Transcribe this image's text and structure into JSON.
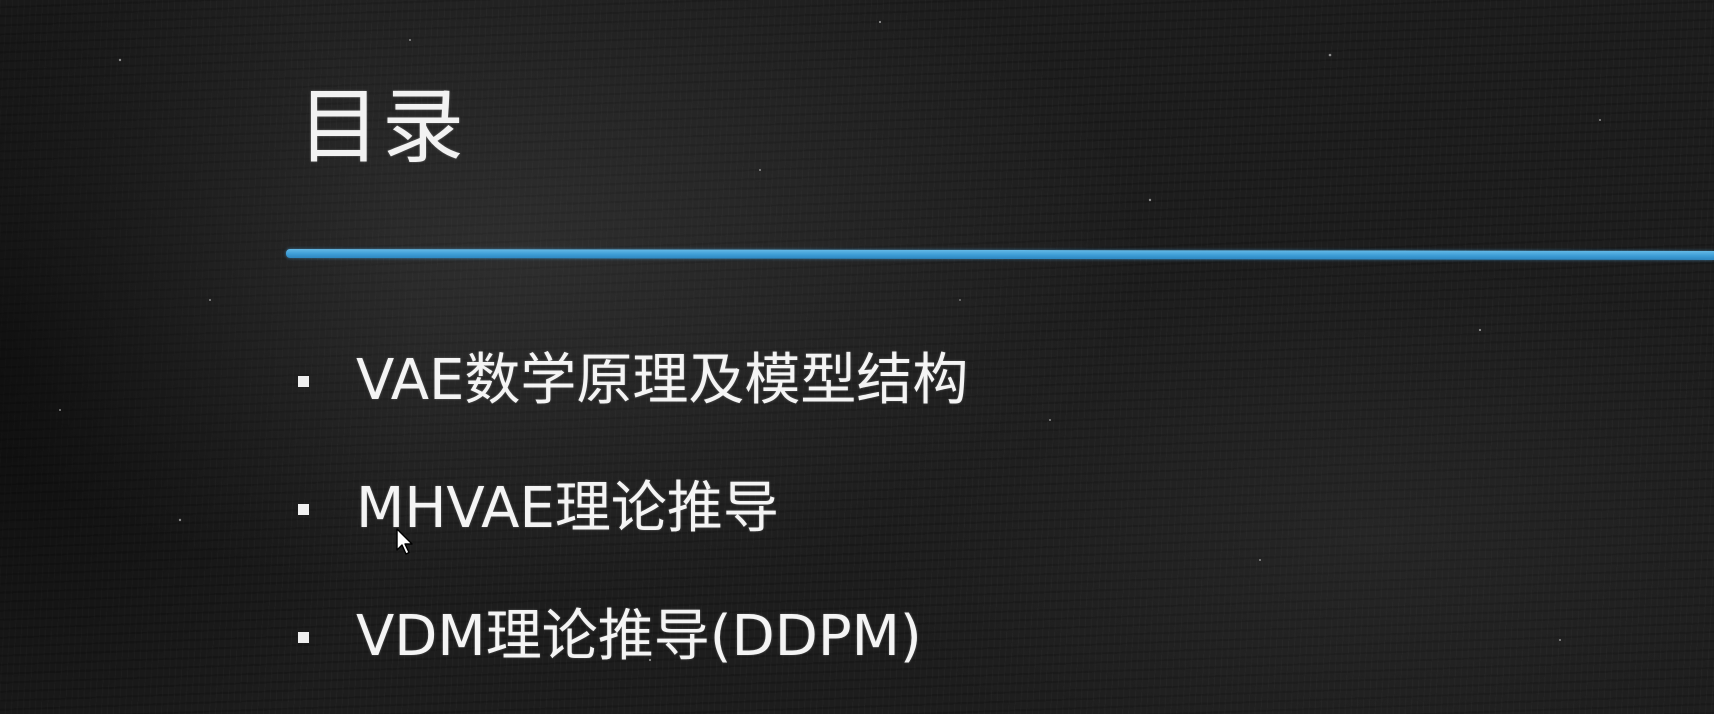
{
  "slide": {
    "title": "目录",
    "accent_color": "#3d9dd6",
    "items": [
      {
        "label": "VAE数学原理及模型结构"
      },
      {
        "label": "MHVAE理论推导"
      },
      {
        "label": "VDM理论推导(DDPM)"
      }
    ]
  },
  "cursor": {
    "icon": "mouse-pointer-icon"
  }
}
